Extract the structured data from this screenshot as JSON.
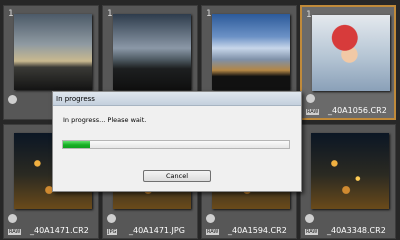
{
  "thumbnails": [
    {
      "file": "",
      "thumb": "sky1",
      "flag": "1",
      "raw": "RAW"
    },
    {
      "file": "",
      "thumb": "sky2",
      "flag": "1",
      "raw": ""
    },
    {
      "file": "",
      "thumb": "sky3",
      "flag": "1",
      "raw": ""
    },
    {
      "file": "_40A1056.CR2",
      "thumb": "girl",
      "flag": "1",
      "raw": "RAW",
      "selected": true
    },
    {
      "file": "_40A1471.CR2",
      "thumb": "night",
      "flag": "",
      "raw": "RAW"
    },
    {
      "file": "_40A1471.JPG",
      "thumb": "night",
      "flag": "",
      "raw": "JPG"
    },
    {
      "file": "_40A1594.CR2",
      "thumb": "night",
      "flag": "",
      "raw": "RAW"
    },
    {
      "file": "_40A3348.CR2",
      "thumb": "night",
      "flag": "",
      "raw": "RAW"
    }
  ],
  "dialog": {
    "title": "In progress",
    "message": "In progress... Please wait.",
    "progress_fraction": 0.12,
    "cancel_label": "Cancel"
  },
  "colors": {
    "progress_fill": "#17b025",
    "selection_border": "#c08a3a"
  }
}
